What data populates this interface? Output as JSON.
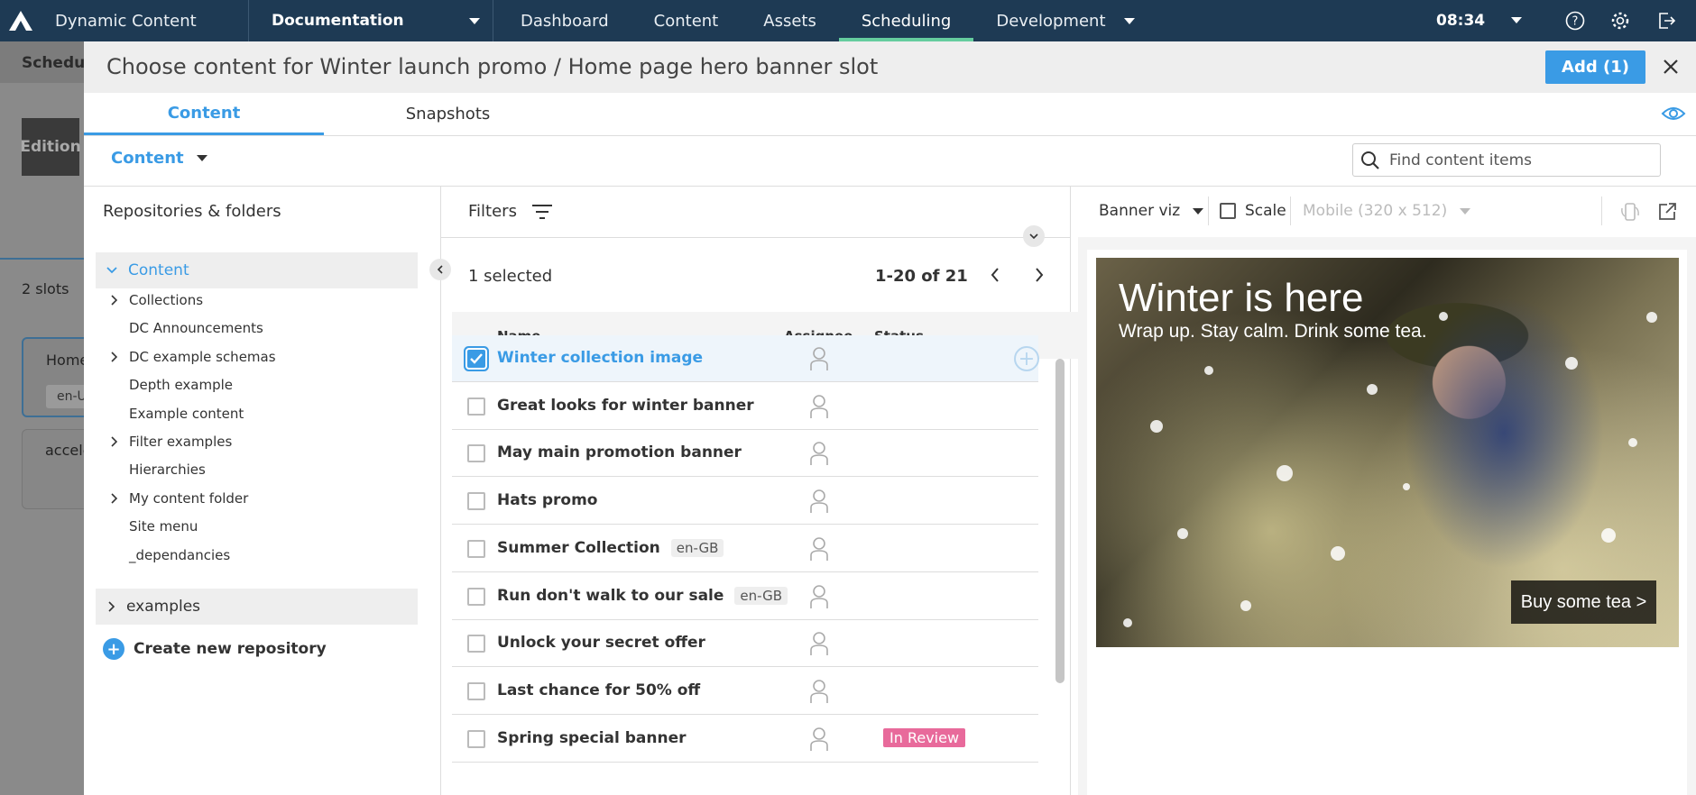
{
  "topnav": {
    "app_title": "Dynamic Content",
    "hub": "Documentation",
    "links": [
      "Dashboard",
      "Content",
      "Assets",
      "Scheduling",
      "Development"
    ],
    "active": "Scheduling",
    "clock": "08:34"
  },
  "background": {
    "sub_title": "Schedulin",
    "edition": "Edition",
    "slots": "2 slots",
    "card1_title": "Home",
    "card1_tag": "en-U",
    "card2_title": "accele"
  },
  "modal": {
    "title": "Choose content for Winter launch promo / Home page hero banner slot",
    "add_button": "Add (1)",
    "tabs": [
      "Content",
      "Snapshots"
    ],
    "content_dropdown": "Content",
    "search_placeholder": "Find content items"
  },
  "tree": {
    "title": "Repositories & folders",
    "root": "Content",
    "items": [
      {
        "label": "Collections",
        "expandable": true
      },
      {
        "label": "DC Announcements",
        "expandable": false
      },
      {
        "label": "DC example schemas",
        "expandable": true
      },
      {
        "label": "Depth example",
        "expandable": false
      },
      {
        "label": "Example content",
        "expandable": false
      },
      {
        "label": "Filter examples",
        "expandable": true
      },
      {
        "label": "Hierarchies",
        "expandable": false
      },
      {
        "label": "My content folder",
        "expandable": true
      },
      {
        "label": "Site menu",
        "expandable": false
      },
      {
        "label": "_dependancies",
        "expandable": false
      }
    ],
    "second_repo": "examples",
    "create_repo": "Create new repository"
  },
  "list": {
    "filters_label": "Filters",
    "selected": "1 selected",
    "pagination": "1-20 of 21",
    "columns": [
      "Name",
      "Assignee",
      "Status"
    ],
    "rows": [
      {
        "name": "Winter collection image",
        "locale": "",
        "status": "",
        "selected": true
      },
      {
        "name": "Great looks for winter banner",
        "locale": "",
        "status": ""
      },
      {
        "name": "May main promotion banner",
        "locale": "",
        "status": ""
      },
      {
        "name": "Hats promo",
        "locale": "",
        "status": ""
      },
      {
        "name": "Summer Collection",
        "locale": "en-GB",
        "status": ""
      },
      {
        "name": "Run don't walk to our sale",
        "locale": "en-GB",
        "status": ""
      },
      {
        "name": "Unlock your secret offer",
        "locale": "",
        "status": ""
      },
      {
        "name": "Last chance for 50% off",
        "locale": "",
        "status": ""
      },
      {
        "name": "Spring special banner",
        "locale": "",
        "status": "In Review"
      }
    ]
  },
  "preview": {
    "visualization": "Banner viz",
    "scale_label": "Scale",
    "device": "Mobile (320 x 512)",
    "banner_title": "Winter is here",
    "banner_subtitle": "Wrap up. Stay calm. Drink some tea.",
    "banner_cta": "Buy some tea >"
  },
  "colors": {
    "nav_bg": "#1e3a54",
    "accent": "#3a9be5",
    "active_underline": "#65cc9e",
    "in_review": "#e86a9b"
  }
}
